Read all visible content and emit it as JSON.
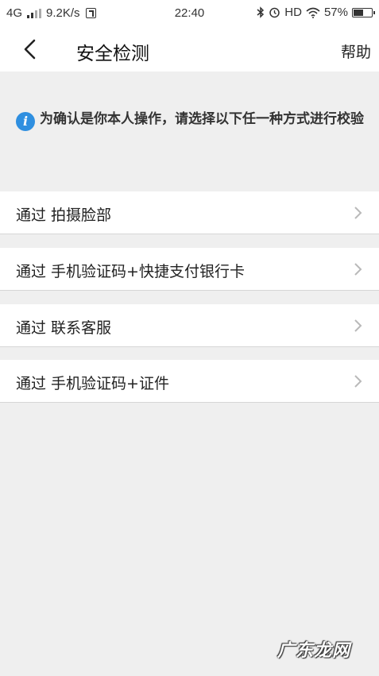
{
  "status_bar": {
    "network": "4G",
    "speed": "9.2K/s",
    "time": "22:40",
    "hd": "HD",
    "battery_text": "57%",
    "battery_level": 0.57
  },
  "nav": {
    "title": "安全检测",
    "help": "帮助"
  },
  "info": {
    "message": "为确认是你本人操作，请选择以下任一种方式进行校验"
  },
  "options": [
    {
      "label": "通过 拍摄脸部"
    },
    {
      "label": "通过 手机验证码+快捷支付银行卡"
    },
    {
      "label": "通过 联系客服"
    },
    {
      "label": "通过 手机验证码+证件"
    }
  ],
  "watermark": "广东龙网",
  "colors": {
    "accent": "#2f8fe0",
    "background": "#efefef",
    "card": "#ffffff"
  }
}
